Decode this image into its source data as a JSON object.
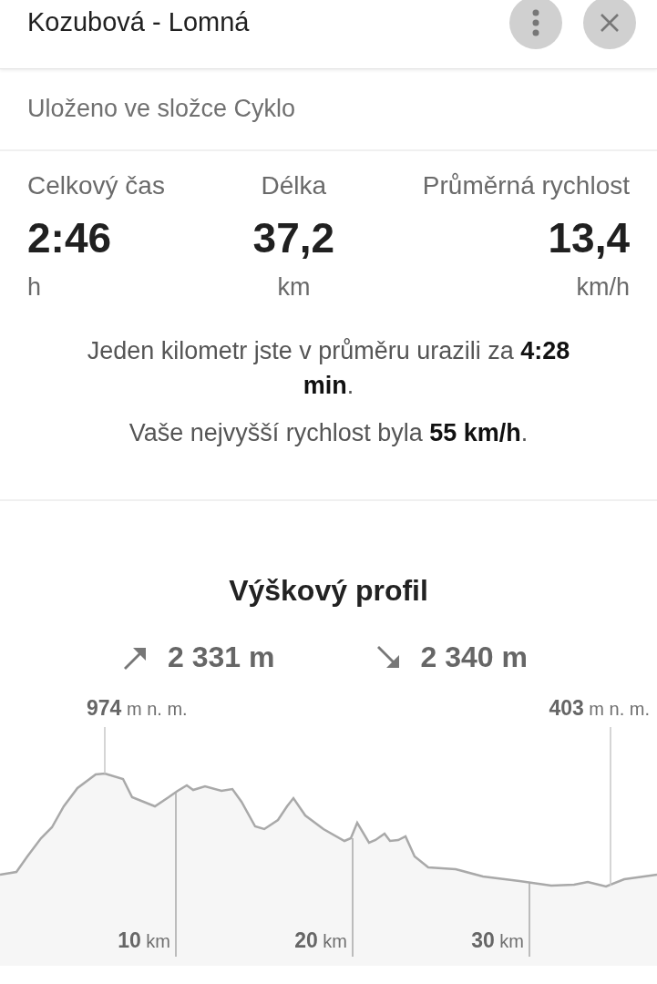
{
  "header": {
    "title": "Kozubová - Lomná"
  },
  "folder_note": "Uloženo ve složce Cyklo",
  "stats": [
    {
      "label": "Celkový čas",
      "value": "2:46",
      "unit": "h"
    },
    {
      "label": "Délka",
      "value": "37,2",
      "unit": "km"
    },
    {
      "label": "Průměrná rychlost",
      "value": "13,4",
      "unit": "km/h"
    }
  ],
  "summary": [
    "Jeden kilometr jste v průměru urazili za **4:28 min**.",
    "Vaše nejvyšší rychlost byla **55 km/h**."
  ],
  "elevation": {
    "title": "Výškový profil",
    "ascent": "2 331 m",
    "descent": "2 340 m",
    "peak_labels": [
      "**974** m n. m.",
      "**403** m n. m."
    ],
    "distance_labels": [
      "**10** km",
      "**20** km",
      "**30** km"
    ]
  }
}
